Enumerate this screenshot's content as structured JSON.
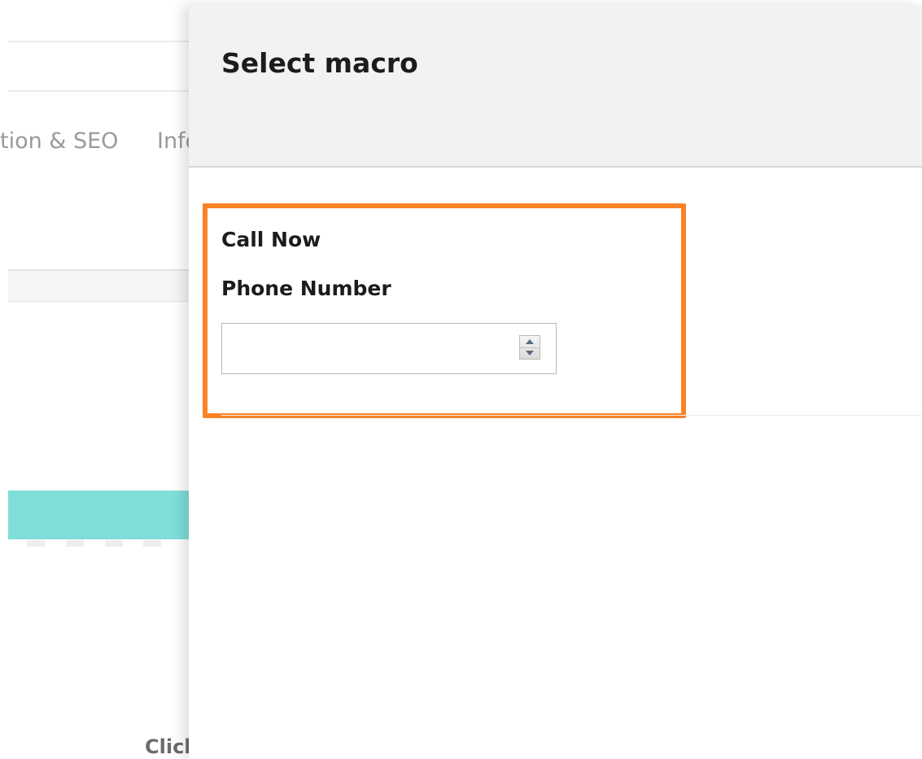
{
  "background": {
    "tab_partial_seo": "tion & SEO",
    "tab_partial_info": "Info",
    "partial_click_text": "Click"
  },
  "panel": {
    "title": "Select macro",
    "macro": {
      "title": "Call Now",
      "field_label": "Phone Number",
      "field_value": "",
      "field_placeholder": ""
    }
  },
  "colors": {
    "highlight": "#fa8225",
    "header_bg": "#f2f2f4",
    "teal_bar": "#7fded8"
  },
  "icons": {
    "spinner_up": "triangle-up",
    "spinner_down": "triangle-down"
  }
}
